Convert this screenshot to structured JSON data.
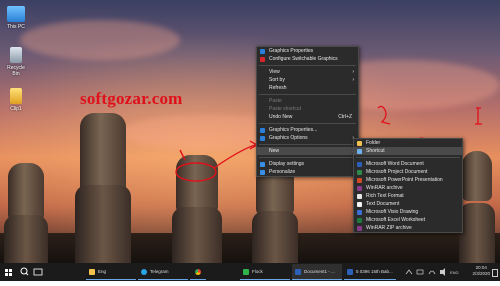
{
  "desktop": {
    "icons": [
      {
        "label": "This PC",
        "icon": "this-pc-icon"
      },
      {
        "label": "Recycle Bin",
        "icon": "recycle-bin-icon"
      },
      {
        "label": "Clip1",
        "icon": "document-icon"
      }
    ],
    "watermark": "softgozar.com",
    "annotation_text": "3"
  },
  "context_menu": {
    "items": [
      {
        "label": "Graphics Properties",
        "icon": "intel-graphics-icon"
      },
      {
        "label": "Configure Switchable Graphics",
        "icon": "amd-icon"
      },
      {
        "label": "View"
      },
      {
        "label": "Sort by"
      },
      {
        "label": "Refresh"
      },
      {
        "label": "Paste"
      },
      {
        "label": "Paste shortcut"
      },
      {
        "label": "Undo New",
        "shortcut": "Ctrl+Z"
      },
      {
        "label": "Graphics Properties...",
        "icon": "intel-graphics-icon"
      },
      {
        "label": "Graphics Options",
        "icon": "intel-graphics-icon"
      },
      {
        "label": "New"
      },
      {
        "label": "Display settings",
        "icon": "display-icon"
      },
      {
        "label": "Personalize",
        "icon": "personalize-icon"
      }
    ]
  },
  "new_submenu": {
    "items": [
      {
        "label": "Folder",
        "icon": "folder-icon"
      },
      {
        "label": "Shortcut",
        "icon": "shortcut-icon"
      },
      {
        "label": "Microsoft Word Document",
        "icon": "word-icon"
      },
      {
        "label": "Microsoft Project Document",
        "icon": "project-icon"
      },
      {
        "label": "Microsoft PowerPoint Presentation",
        "icon": "powerpoint-icon"
      },
      {
        "label": "WinRAR archive",
        "icon": "winrar-icon"
      },
      {
        "label": "Rich Text Format",
        "icon": "rtf-icon"
      },
      {
        "label": "Text Document",
        "icon": "text-icon"
      },
      {
        "label": "Microsoft Visio Drawing",
        "icon": "visio-icon"
      },
      {
        "label": "Microsoft Excel Worksheet",
        "icon": "excel-icon"
      },
      {
        "label": "WinRAR ZIP archive",
        "icon": "winrar-zip-icon"
      }
    ]
  },
  "taskbar": {
    "apps": [
      {
        "label": "Eng",
        "icon": "folder-icon"
      },
      {
        "label": "Telegram",
        "icon": "telegram-icon"
      },
      {
        "label": "",
        "icon": "chrome-icon"
      },
      {
        "label": "Flock",
        "icon": "flock-icon"
      },
      {
        "label": "Document1 - ...",
        "icon": "word-icon"
      },
      {
        "label": "5 0396 15th Bab...",
        "icon": "document-icon"
      }
    ],
    "clock_time": "20:04",
    "clock_date": "2/3/2020"
  },
  "colors": {
    "menu_bg": "#2b2b2b",
    "annotation": "#e0101a",
    "highlight": "#4a4a4a",
    "taskbar": "#1b1b1b"
  }
}
